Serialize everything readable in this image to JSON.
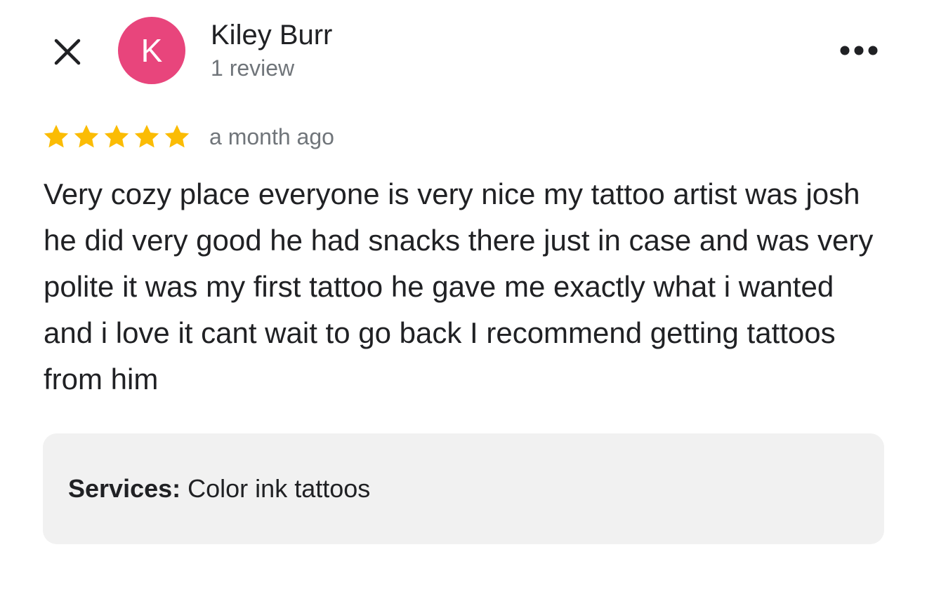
{
  "header": {
    "close_icon": "close-icon",
    "avatar": {
      "initial": "K",
      "color": "#e8457c"
    },
    "reviewer_name": "Kiley Burr",
    "review_count": "1 review",
    "more_icon": "more-horizontal-icon"
  },
  "review": {
    "rating": 5,
    "rating_max": 5,
    "star_color": "#fbbc04",
    "date": "a month ago",
    "text": "Very cozy place everyone is very nice my tattoo artist was josh he did very good he had snacks there just in case and was very polite it was my first tattoo he gave me exactly what i wanted and i love it cant wait to go back I recommend getting tattoos from him"
  },
  "services": {
    "label": "Services:",
    "value": "Color ink tattoos"
  }
}
